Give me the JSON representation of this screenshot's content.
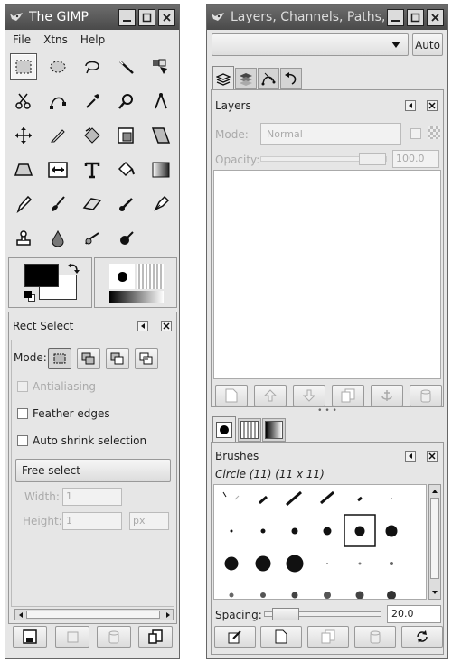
{
  "toolbox": {
    "title": "The GIMP",
    "menu": [
      "File",
      "Xtns",
      "Help"
    ],
    "tools": [
      "rect-select",
      "ellipse-select",
      "lasso",
      "magic-wand",
      "select-by-color",
      "scissors",
      "paths",
      "color-picker",
      "zoom",
      "measure",
      "move",
      "crop",
      "rotate",
      "scale",
      "shear",
      "perspective",
      "flip",
      "text",
      "bucket-fill",
      "blend",
      "pencil",
      "paintbrush",
      "eraser",
      "airbrush",
      "ink",
      "clone",
      "blur",
      "smudge",
      "dodge"
    ],
    "tool_options": {
      "title": "Rect Select",
      "mode_label": "Mode:",
      "antialiasing": "Antialiasing",
      "feather": "Feather edges",
      "auto_shrink": "Auto shrink selection",
      "free_select": "Free select",
      "width_label": "Width:",
      "width_value": "1",
      "height_label": "Height:",
      "height_value": "1",
      "unit": "px"
    }
  },
  "dock": {
    "title": "Layers, Channels, Paths,",
    "auto_label": "Auto",
    "layers": {
      "title": "Layers",
      "mode_label": "Mode:",
      "mode_value": "Normal",
      "opacity_label": "Opacity:",
      "opacity_value": "100.0"
    },
    "brushes": {
      "title": "Brushes",
      "current": "Circle (11)  (11 x 11)",
      "spacing_label": "Spacing:",
      "spacing_value": "20.0"
    }
  }
}
